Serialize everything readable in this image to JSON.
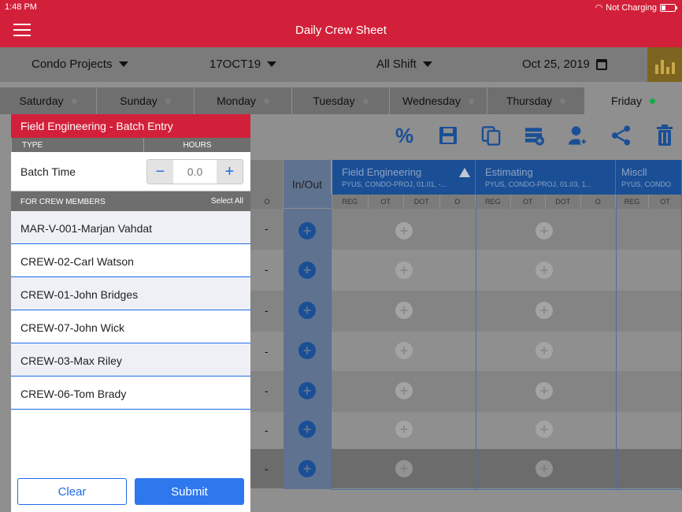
{
  "status_bar": {
    "time": "1:48 PM",
    "charging": "Not Charging"
  },
  "header": {
    "title": "Daily Crew Sheet"
  },
  "filters": {
    "project": "Condo Projects",
    "sheet": "17OCT19",
    "shift": "All Shift",
    "date": "Oct 25, 2019"
  },
  "days": [
    {
      "label": "Saturday"
    },
    {
      "label": "Sunday"
    },
    {
      "label": "Monday"
    },
    {
      "label": "Tuesday"
    },
    {
      "label": "Wednesday"
    },
    {
      "label": "Thursday"
    },
    {
      "label": "Friday"
    }
  ],
  "active_day": "Friday",
  "grid": {
    "inout_label": "In/Out",
    "o_label": "O",
    "groups": [
      {
        "name": "Field Engineering",
        "sub": "PYUS, CONDO-PROJ, 01.01, -..."
      },
      {
        "name": "Estimating",
        "sub": "PYUS, CONDO-PROJ, 01.03, 1..."
      },
      {
        "name": "Miscll",
        "sub": "PYUS, CONDO"
      }
    ],
    "subcols": [
      "REG",
      "OT",
      "DOT",
      "O"
    ],
    "misc_subcols": [
      "REG",
      "OT"
    ],
    "row_value": "-"
  },
  "panel": {
    "title": "Field Engineering - Batch Entry",
    "type_label": "TYPE",
    "hours_label": "HOURS",
    "batch_label": "Batch Time",
    "hours_placeholder": "0.0",
    "minus": "−",
    "plus": "+",
    "crew_label": "FOR CREW MEMBERS",
    "select_all": "Select All",
    "crew": [
      "MAR-V-001-Marjan Vahdat",
      "CREW-02-Carl Watson",
      "CREW-01-John Bridges",
      "CREW-07-John Wick",
      "CREW-03-Max Riley",
      "CREW-06-Tom Brady"
    ],
    "clear": "Clear",
    "submit": "Submit"
  }
}
